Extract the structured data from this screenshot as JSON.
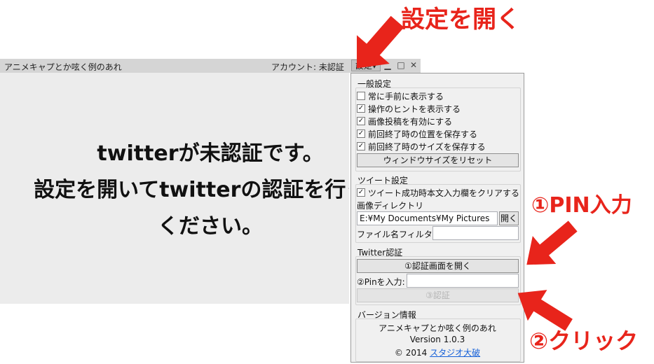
{
  "window": {
    "title": "アニメキャプとか呟く例のあれ",
    "account_label": "アカウント: 未認証",
    "settings_button": "設定▾",
    "minimize": "▁",
    "maximize": "□",
    "close": "✕"
  },
  "main": {
    "message_line1": "twitterが未認証です。",
    "message_line2": "設定を開いてtwitterの認証を行って",
    "message_line3": "ください。"
  },
  "settings": {
    "general": {
      "title": "一般設定",
      "options": [
        {
          "label": "常に手前に表示する",
          "checked": false
        },
        {
          "label": "操作のヒントを表示する",
          "checked": true
        },
        {
          "label": "画像投稿を有効にする",
          "checked": true
        },
        {
          "label": "前回終了時の位置を保存する",
          "checked": true
        },
        {
          "label": "前回終了時のサイズを保存する",
          "checked": true
        }
      ],
      "reset_button": "ウィンドウサイズをリセット"
    },
    "tweet": {
      "title": "ツイート設定",
      "clear_option": {
        "label": "ツイート成功時本文入力欄をクリアする",
        "checked": true
      },
      "image_dir_label": "画像ディレクトリ",
      "image_dir_value": "E:¥My Documents¥My Pictures",
      "open_button": "開く",
      "filter_label": "ファイル名フィルタ",
      "filter_value": ""
    },
    "twitter": {
      "title": "Twitter認証",
      "open_auth_button": "①認証画面を開く",
      "pin_label": "②Pinを入力:",
      "pin_value": "",
      "auth_button": "③認証"
    },
    "version": {
      "title": "バージョン情報",
      "app_name": "アニメキャプとか呟く例のあれ",
      "version": "Version 1.0.3",
      "copyright": "© 2014",
      "studio_link": "スタジオ大破"
    }
  },
  "annotations": {
    "open_settings": "設定を開く",
    "pin_input": "①PIN入力",
    "click": "②クリック",
    "color": "#e8241b"
  }
}
